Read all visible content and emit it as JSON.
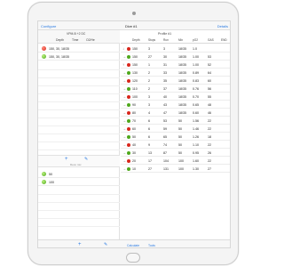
{
  "navbar": {
    "left": "Configure",
    "title": "Dive #1",
    "right": "Details"
  },
  "left_header": {
    "mix_line": "VPM-B  +2  DC",
    "col_depth": "Depth",
    "col_time": "Time",
    "col_gas": "O2/He"
  },
  "plans": [
    {
      "color": "red",
      "text": "150, 30, 18/35"
    },
    {
      "color": "green",
      "text": "150, 30, 18/35"
    }
  ],
  "gases": [
    {
      "color": "green",
      "text": "50"
    },
    {
      "color": "green",
      "text": "100"
    }
  ],
  "mid_toolbar": {
    "caption": "Deco mix"
  },
  "right_header": {
    "title": "Profile #1",
    "columns": [
      "Depth",
      "Stops",
      "Run",
      "Mix",
      "pO2",
      "GAS",
      "END"
    ]
  },
  "rows": [
    {
      "arrow": "↓",
      "depth": "150",
      "stops": "3",
      "run": "3",
      "mix": "18/35",
      "po2": "1.0",
      "gas": "",
      "end": ""
    },
    {
      "arrow": "→",
      "depth": "150",
      "stops": "27",
      "run": "30",
      "mix": "18/35",
      "po2": "1.00",
      "gas": "53",
      "end": ""
    },
    {
      "arrow": "↑",
      "depth": "150",
      "stops": "1",
      "run": "31",
      "mix": "18/35",
      "po2": "1.00",
      "gas": "52",
      "end": ""
    },
    {
      "arrow": "→",
      "depth": "130",
      "stops": "2",
      "run": "33",
      "mix": "18/35",
      "po2": "0.89",
      "gas": "64",
      "end": ""
    },
    {
      "arrow": "→",
      "depth": "120",
      "stops": "2",
      "run": "35",
      "mix": "18/35",
      "po2": "0.83",
      "gas": "60",
      "end": ""
    },
    {
      "arrow": "→",
      "depth": "110",
      "stops": "2",
      "run": "37",
      "mix": "18/35",
      "po2": "0.76",
      "gas": "56",
      "end": ""
    },
    {
      "arrow": "→",
      "depth": "100",
      "stops": "3",
      "run": "40",
      "mix": "18/35",
      "po2": "0.70",
      "gas": "55",
      "end": ""
    },
    {
      "arrow": "→",
      "depth": "90",
      "stops": "3",
      "run": "43",
      "mix": "18/35",
      "po2": "0.65",
      "gas": "48",
      "end": ""
    },
    {
      "arrow": "→",
      "depth": "80",
      "stops": "4",
      "run": "47",
      "mix": "18/35",
      "po2": "0.60",
      "gas": "46",
      "end": ""
    },
    {
      "arrow": "→",
      "depth": "70",
      "stops": "6",
      "run": "53",
      "mix": "50",
      "po2": "1.56",
      "gas": "22",
      "end": ""
    },
    {
      "arrow": "→",
      "depth": "60",
      "stops": "6",
      "run": "59",
      "mix": "50",
      "po2": "1.46",
      "gas": "22",
      "end": ""
    },
    {
      "arrow": "→",
      "depth": "50",
      "stops": "6",
      "run": "65",
      "mix": "50",
      "po2": "1.26",
      "gas": "18",
      "end": ""
    },
    {
      "arrow": "→",
      "depth": "40",
      "stops": "9",
      "run": "74",
      "mix": "50",
      "po2": "1.10",
      "gas": "22",
      "end": ""
    },
    {
      "arrow": "→",
      "depth": "30",
      "stops": "13",
      "run": "87",
      "mix": "50",
      "po2": "0.95",
      "gas": "26",
      "end": ""
    },
    {
      "arrow": "→",
      "depth": "20",
      "stops": "17",
      "run": "104",
      "mix": "100",
      "po2": "1.60",
      "gas": "22",
      "end": ""
    },
    {
      "arrow": "→",
      "depth": "10",
      "stops": "27",
      "run": "131",
      "mix": "100",
      "po2": "1.30",
      "gas": "27",
      "end": ""
    }
  ],
  "bottom_bar": {
    "add": "+",
    "calculate": "Calculate",
    "tools": "Tools"
  },
  "colors": {
    "accent": "#2a7ae2",
    "red": "#d9261c",
    "green": "#4ea81c"
  }
}
